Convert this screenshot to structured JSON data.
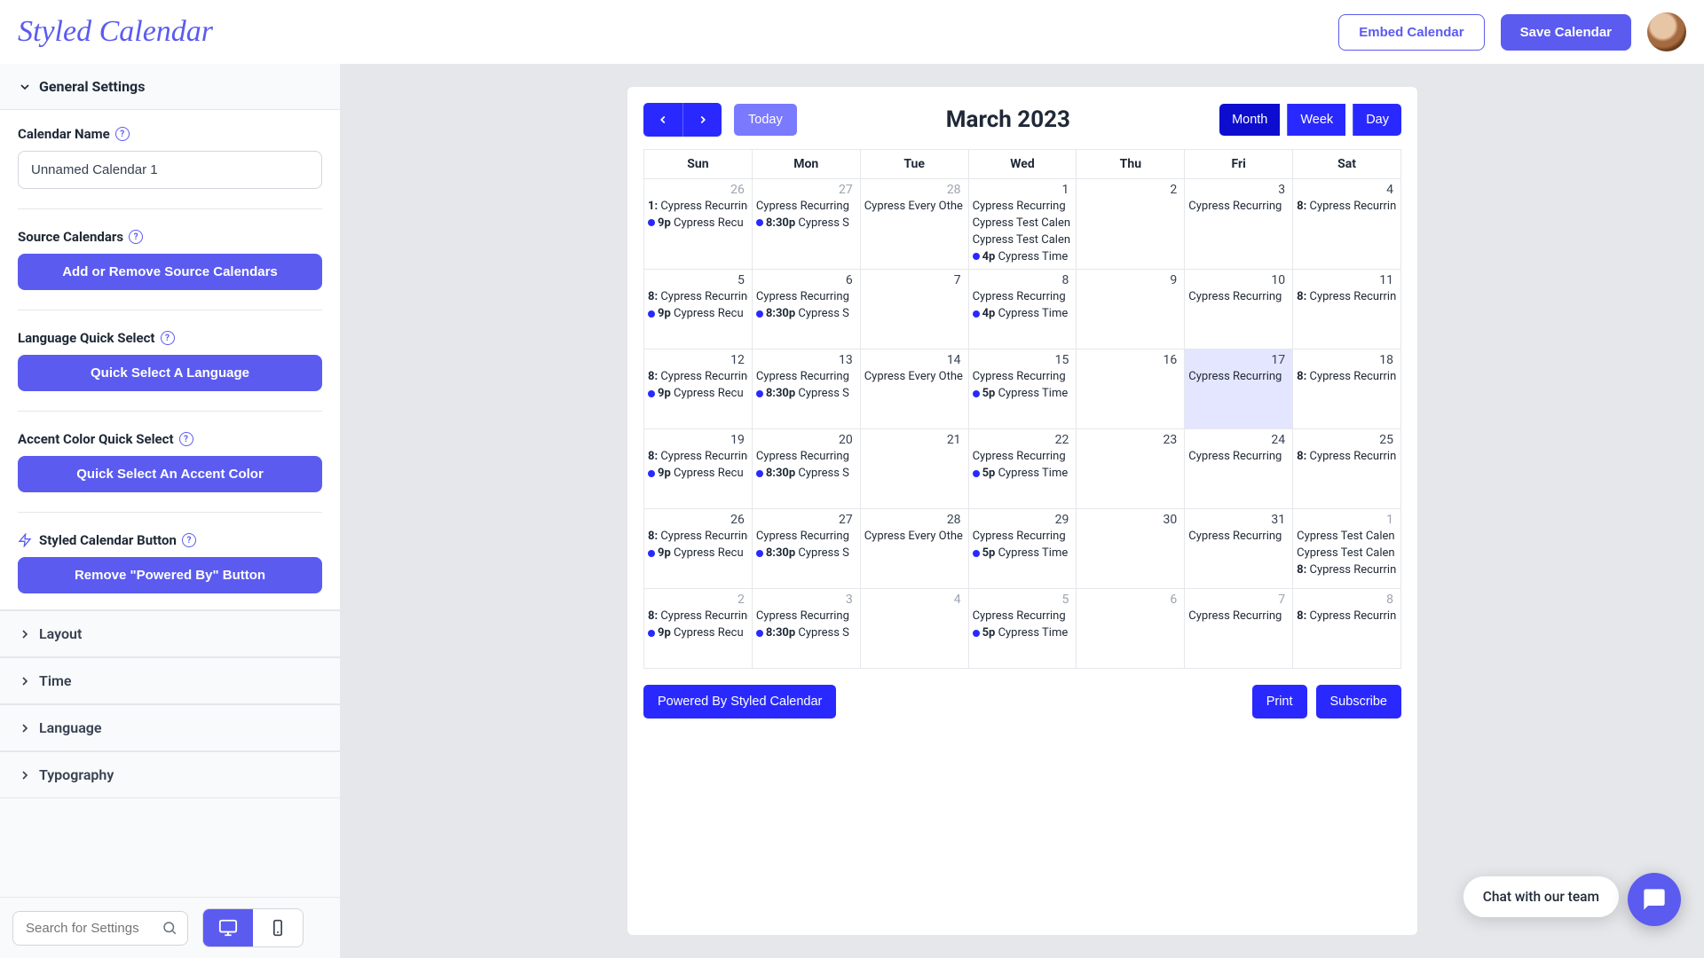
{
  "header": {
    "logo": "Styled Calendar",
    "embed": "Embed Calendar",
    "save": "Save Calendar"
  },
  "sidebar": {
    "general_title": "General Settings",
    "calendar_name_label": "Calendar Name",
    "calendar_name_value": "Unnamed Calendar 1",
    "source_label": "Source Calendars",
    "source_btn": "Add or Remove Source Calendars",
    "lang_label": "Language Quick Select",
    "lang_btn": "Quick Select A Language",
    "accent_label": "Accent Color Quick Select",
    "accent_btn": "Quick Select An Accent Color",
    "styled_btn_label": "Styled Calendar Button",
    "powered_btn": "Remove \"Powered By\" Button",
    "sections": [
      "Layout",
      "Time",
      "Language",
      "Typography"
    ],
    "search_placeholder": "Search for Settings"
  },
  "calendar": {
    "today": "Today",
    "title": "March 2023",
    "views": [
      "Month",
      "Week",
      "Day"
    ],
    "active_view": "Month",
    "dow": [
      "Sun",
      "Mon",
      "Tue",
      "Wed",
      "Thu",
      "Fri",
      "Sat"
    ],
    "powered": "Powered By Styled Calendar",
    "print": "Print",
    "subscribe": "Subscribe",
    "weeks": [
      [
        {
          "d": "26",
          "other": true,
          "ev": [
            {
              "pre": "1:",
              "t": "Cypress Recurring"
            },
            {
              "dot": true,
              "pre": "9p",
              "t": "Cypress Recu"
            }
          ]
        },
        {
          "d": "27",
          "other": true,
          "ev": [
            {
              "t": "Cypress Recurring"
            },
            {
              "dot": true,
              "pre": "8:30p",
              "t": "Cypress S"
            }
          ]
        },
        {
          "d": "28",
          "other": true,
          "ev": [
            {
              "t": "Cypress Every Othe"
            }
          ]
        },
        {
          "d": "1",
          "ev": [
            {
              "t": "Cypress Recurring"
            },
            {
              "t": "Cypress Test Calen"
            },
            {
              "t": "Cypress Test Calen"
            },
            {
              "dot": true,
              "pre": "4p",
              "t": "Cypress Time"
            }
          ]
        },
        {
          "d": "2",
          "ev": []
        },
        {
          "d": "3",
          "ev": [
            {
              "t": "Cypress Recurring"
            }
          ]
        },
        {
          "d": "4",
          "ev": [
            {
              "pre": "8:",
              "t": "Cypress Recurrin"
            }
          ]
        }
      ],
      [
        {
          "d": "5",
          "ev": [
            {
              "pre": "8:",
              "t": "Cypress Recurring"
            },
            {
              "dot": true,
              "pre": "9p",
              "t": "Cypress Recu"
            }
          ]
        },
        {
          "d": "6",
          "ev": [
            {
              "t": "Cypress Recurring"
            },
            {
              "dot": true,
              "pre": "8:30p",
              "t": "Cypress S"
            }
          ]
        },
        {
          "d": "7",
          "ev": []
        },
        {
          "d": "8",
          "ev": [
            {
              "t": "Cypress Recurring"
            },
            {
              "dot": true,
              "pre": "4p",
              "t": "Cypress Time"
            }
          ]
        },
        {
          "d": "9",
          "ev": []
        },
        {
          "d": "10",
          "ev": [
            {
              "t": "Cypress Recurring"
            }
          ]
        },
        {
          "d": "11",
          "ev": [
            {
              "pre": "8:",
              "t": "Cypress Recurrin"
            }
          ]
        }
      ],
      [
        {
          "d": "12",
          "ev": [
            {
              "pre": "8:",
              "t": "Cypress Recurring"
            },
            {
              "dot": true,
              "pre": "9p",
              "t": "Cypress Recu"
            }
          ]
        },
        {
          "d": "13",
          "ev": [
            {
              "t": "Cypress Recurring"
            },
            {
              "dot": true,
              "pre": "8:30p",
              "t": "Cypress S"
            }
          ]
        },
        {
          "d": "14",
          "ev": [
            {
              "t": "Cypress Every Othe"
            }
          ]
        },
        {
          "d": "15",
          "ev": [
            {
              "t": "Cypress Recurring"
            },
            {
              "dot": true,
              "pre": "5p",
              "t": "Cypress Time"
            }
          ]
        },
        {
          "d": "16",
          "ev": []
        },
        {
          "d": "17",
          "today": true,
          "ev": [
            {
              "t": "Cypress Recurring"
            }
          ]
        },
        {
          "d": "18",
          "ev": [
            {
              "pre": "8:",
              "t": "Cypress Recurrin"
            }
          ]
        }
      ],
      [
        {
          "d": "19",
          "ev": [
            {
              "pre": "8:",
              "t": "Cypress Recurring"
            },
            {
              "dot": true,
              "pre": "9p",
              "t": "Cypress Recu"
            }
          ]
        },
        {
          "d": "20",
          "ev": [
            {
              "t": "Cypress Recurring"
            },
            {
              "dot": true,
              "pre": "8:30p",
              "t": "Cypress S"
            }
          ]
        },
        {
          "d": "21",
          "ev": []
        },
        {
          "d": "22",
          "ev": [
            {
              "t": "Cypress Recurring"
            },
            {
              "dot": true,
              "pre": "5p",
              "t": "Cypress Time"
            }
          ]
        },
        {
          "d": "23",
          "ev": []
        },
        {
          "d": "24",
          "ev": [
            {
              "t": "Cypress Recurring"
            }
          ]
        },
        {
          "d": "25",
          "ev": [
            {
              "pre": "8:",
              "t": "Cypress Recurrin"
            }
          ]
        }
      ],
      [
        {
          "d": "26",
          "ev": [
            {
              "pre": "8:",
              "t": "Cypress Recurring"
            },
            {
              "dot": true,
              "pre": "9p",
              "t": "Cypress Recu"
            }
          ]
        },
        {
          "d": "27",
          "ev": [
            {
              "t": "Cypress Recurring"
            },
            {
              "dot": true,
              "pre": "8:30p",
              "t": "Cypress S"
            }
          ]
        },
        {
          "d": "28",
          "ev": [
            {
              "t": "Cypress Every Othe"
            }
          ]
        },
        {
          "d": "29",
          "ev": [
            {
              "t": "Cypress Recurring"
            },
            {
              "dot": true,
              "pre": "5p",
              "t": "Cypress Time"
            }
          ]
        },
        {
          "d": "30",
          "ev": []
        },
        {
          "d": "31",
          "ev": [
            {
              "t": "Cypress Recurring"
            }
          ]
        },
        {
          "d": "1",
          "other": true,
          "ev": [
            {
              "t": "Cypress Test Calen"
            },
            {
              "t": "Cypress Test Calen"
            },
            {
              "pre": "8:",
              "t": "Cypress Recurrin"
            }
          ]
        }
      ],
      [
        {
          "d": "2",
          "other": true,
          "ev": [
            {
              "pre": "8:",
              "t": "Cypress Recurring"
            },
            {
              "dot": true,
              "pre": "9p",
              "t": "Cypress Recu"
            }
          ]
        },
        {
          "d": "3",
          "other": true,
          "ev": [
            {
              "t": "Cypress Recurring"
            },
            {
              "dot": true,
              "pre": "8:30p",
              "t": "Cypress S"
            }
          ]
        },
        {
          "d": "4",
          "other": true,
          "ev": []
        },
        {
          "d": "5",
          "other": true,
          "ev": [
            {
              "t": "Cypress Recurring"
            },
            {
              "dot": true,
              "pre": "5p",
              "t": "Cypress Time"
            }
          ]
        },
        {
          "d": "6",
          "other": true,
          "ev": []
        },
        {
          "d": "7",
          "other": true,
          "ev": [
            {
              "t": "Cypress Recurring"
            }
          ]
        },
        {
          "d": "8",
          "other": true,
          "ev": [
            {
              "pre": "8:",
              "t": "Cypress Recurrin"
            }
          ]
        }
      ]
    ]
  },
  "chat": {
    "pill": "Chat with our team"
  }
}
